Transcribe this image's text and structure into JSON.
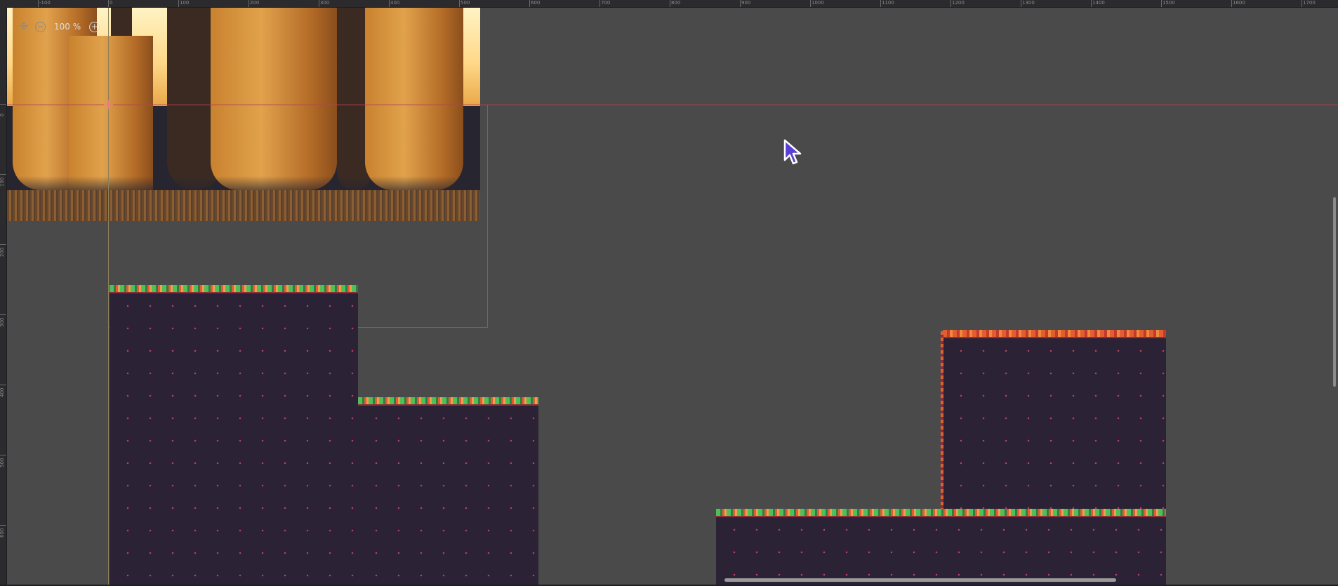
{
  "zoom": {
    "level_label": "100 %",
    "icons": [
      "center-view-icon",
      "zoom-out-icon",
      "zoom-in-icon"
    ]
  },
  "ruler_top": {
    "labels": [
      "-100",
      "0",
      "100",
      "200",
      "300",
      "400",
      "500",
      "600",
      "700",
      "800",
      "900",
      "1000",
      "1100",
      "1200",
      "1300",
      "1400",
      "1500",
      "1600",
      "1700"
    ]
  },
  "ruler_left": {
    "labels": [
      "0",
      "100",
      "200",
      "300",
      "400",
      "500",
      "600"
    ]
  },
  "colors": {
    "canvas_bg": "#4a4a4a",
    "guide_horizontal": "#b8414e",
    "guide_vertical": "#8d7f5a",
    "camera_rect": "#6b5fa0",
    "tile_dark": "#2b2236",
    "grass_green": "#4fbf5a",
    "grass_red": "#e25d2f",
    "cursor": "#5a3fd6"
  },
  "scene": {
    "background_layer": "forest-parallax",
    "tilemap": "ground-tiles"
  }
}
